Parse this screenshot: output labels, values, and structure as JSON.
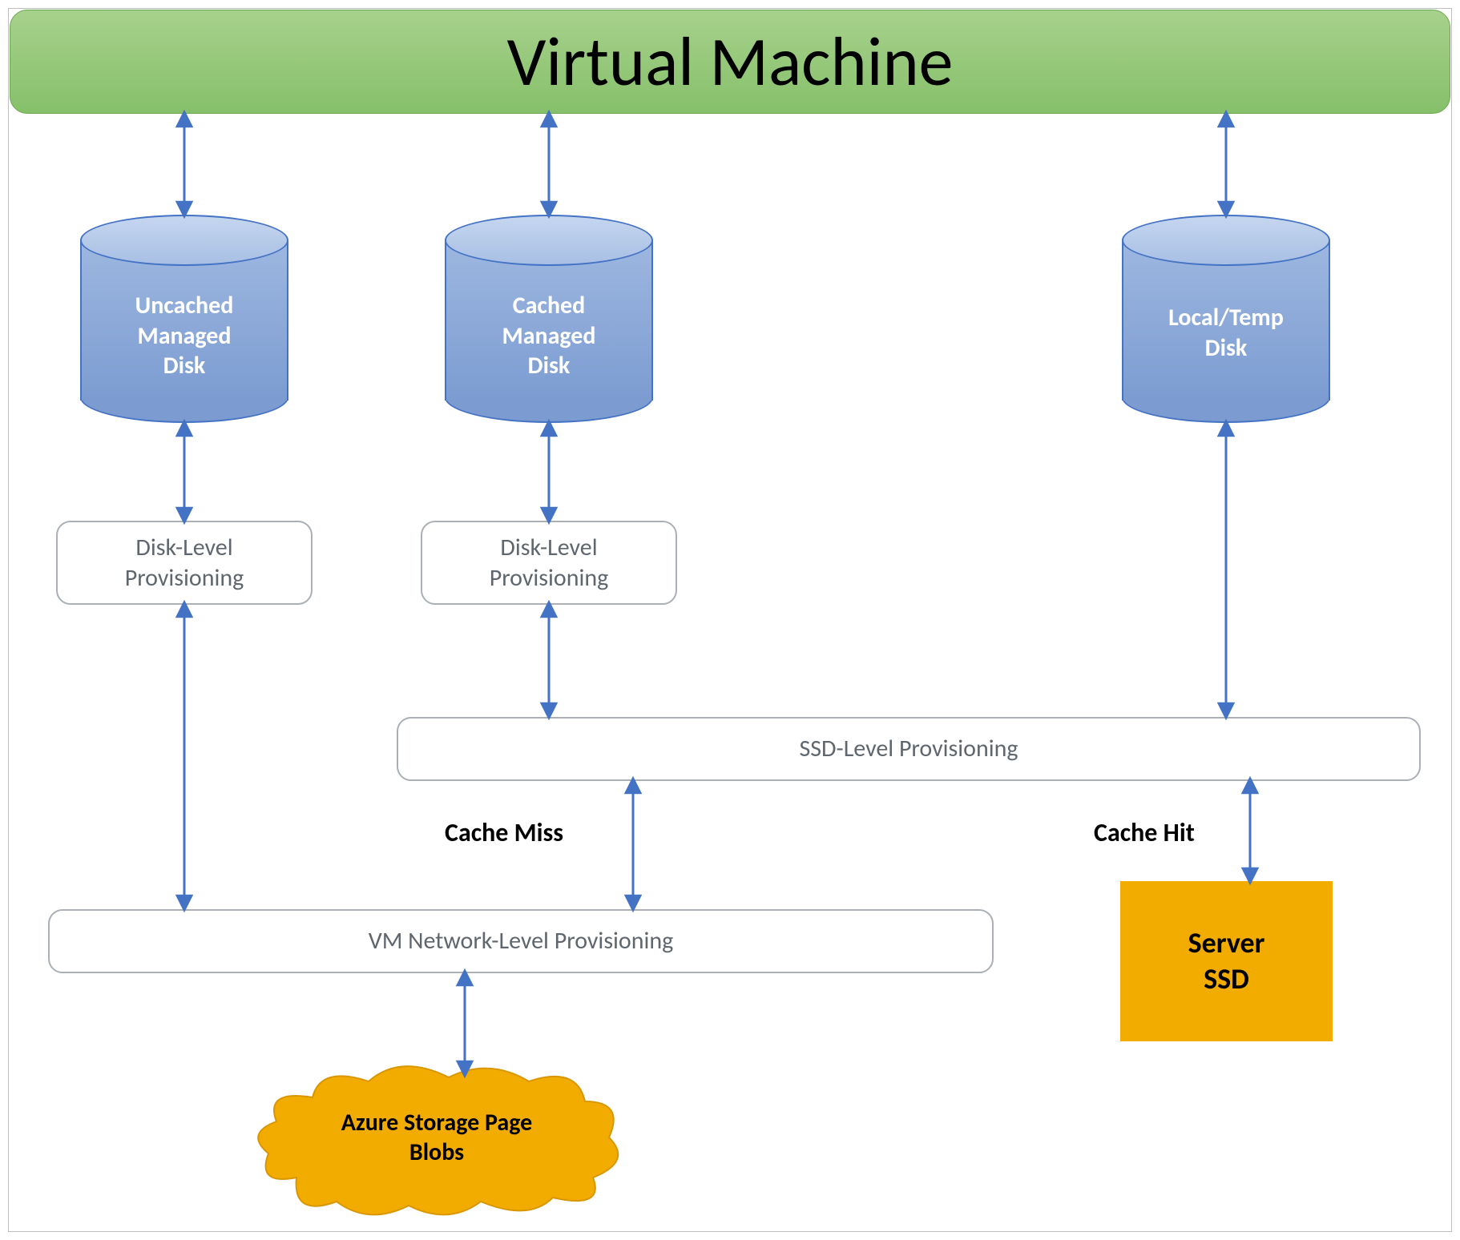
{
  "title": "Virtual Machine",
  "cyl_uncached": "Uncached\nManaged\nDisk",
  "cyl_cached": "Cached\nManaged\nDisk",
  "cyl_local": "Local/Temp\nDisk",
  "box_disk_prov_1": "Disk-Level\nProvisioning",
  "box_disk_prov_2": "Disk-Level\nProvisioning",
  "box_ssd_prov": "SSD-Level Provisioning",
  "box_vm_net_prov": "VM Network-Level Provisioning",
  "label_cache_miss": "Cache Miss",
  "label_cache_hit": "Cache Hit",
  "server_ssd": "Server\nSSD",
  "cloud_label": "Azure Storage Page\nBlobs",
  "colors": {
    "title_fill": "#8cbf72",
    "title_border": "#6aa84f",
    "cyl_fill": "#8fa9d8",
    "cyl_border": "#4472c4",
    "box_border": "#aab0b6",
    "box_text": "#5f666d",
    "arrow": "#4472c4",
    "orange": "#f2ac00"
  }
}
